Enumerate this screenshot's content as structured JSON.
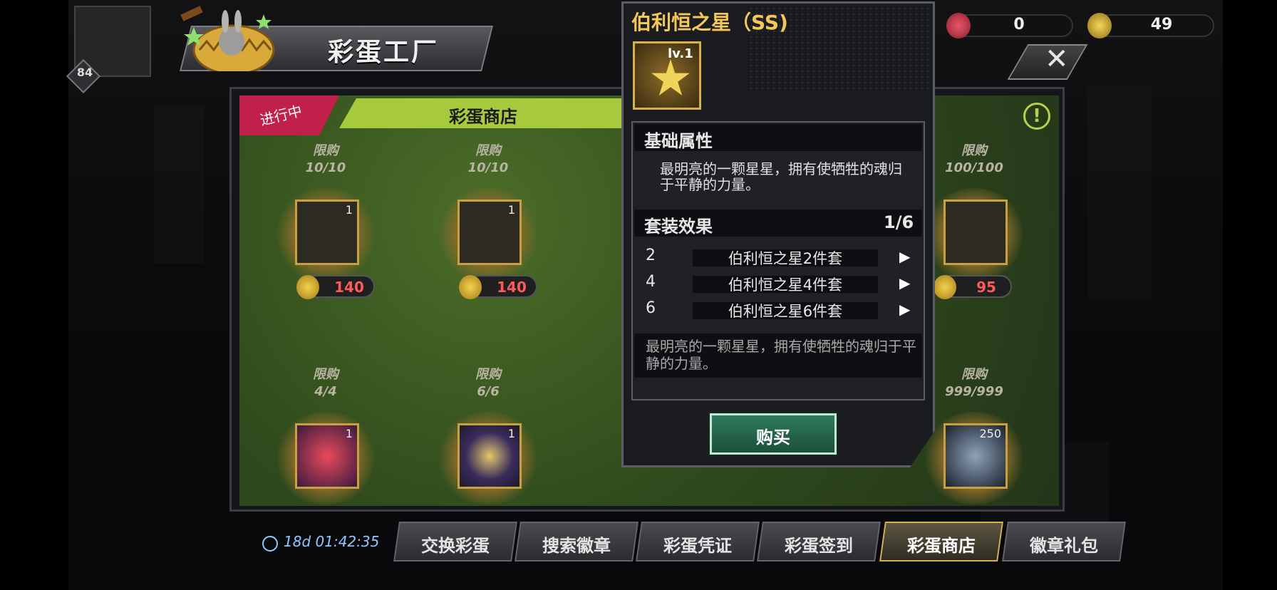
{
  "header": {
    "title": "彩蛋工厂",
    "player_level": "84"
  },
  "currencies": [
    {
      "name": "rabbit-token",
      "value": "0",
      "color": "#c62a3a"
    },
    {
      "name": "golden-egg",
      "value": "49",
      "color": "#e6c23a"
    }
  ],
  "shop": {
    "status_tab": "进行中",
    "title": "彩蛋商店",
    "items": [
      {
        "limit_label": "限购",
        "limit": "10/10",
        "qty": "1",
        "price": "140"
      },
      {
        "limit_label": "限购",
        "limit": "10/10",
        "qty": "1",
        "price": "140"
      },
      {
        "limit_label": "限购",
        "limit": "100/100",
        "qty": "",
        "price": "95"
      },
      {
        "limit_label": "限购",
        "limit": "4/4",
        "qty": "1",
        "price": ""
      },
      {
        "limit_label": "限购",
        "limit": "6/6",
        "qty": "1",
        "price": ""
      },
      {
        "limit_label": "限购",
        "limit": "999/999",
        "qty": "250",
        "price": ""
      }
    ]
  },
  "popup": {
    "title": "伯利恒之星（SS)",
    "level": "lv.1",
    "base_attr_heading": "基础属性",
    "description": "最明亮的一颗星星，拥有使牺牲的魂归于平静的力量。",
    "set_heading": "套装效果",
    "set_ratio": "1/6",
    "set_rows": [
      {
        "count": "2",
        "name": "伯利恒之星2件套"
      },
      {
        "count": "4",
        "name": "伯利恒之星4件套"
      },
      {
        "count": "6",
        "name": "伯利恒之星6件套"
      }
    ],
    "flavor": "最明亮的一颗星星，拥有使牺牲的魂归于平静的力量。",
    "buy_label": "购买"
  },
  "bottom": {
    "timer": "18d 01:42:35",
    "tabs": [
      "交换彩蛋",
      "搜索徽章",
      "彩蛋凭证",
      "彩蛋签到",
      "彩蛋商店",
      "徽章礼包"
    ],
    "active_tab_index": 4
  },
  "colors": {
    "accent_green": "#a7c93e",
    "progress_red": "#c0204a",
    "popup_gold": "#f3c75a",
    "buy_green": "#2d7a5c"
  }
}
